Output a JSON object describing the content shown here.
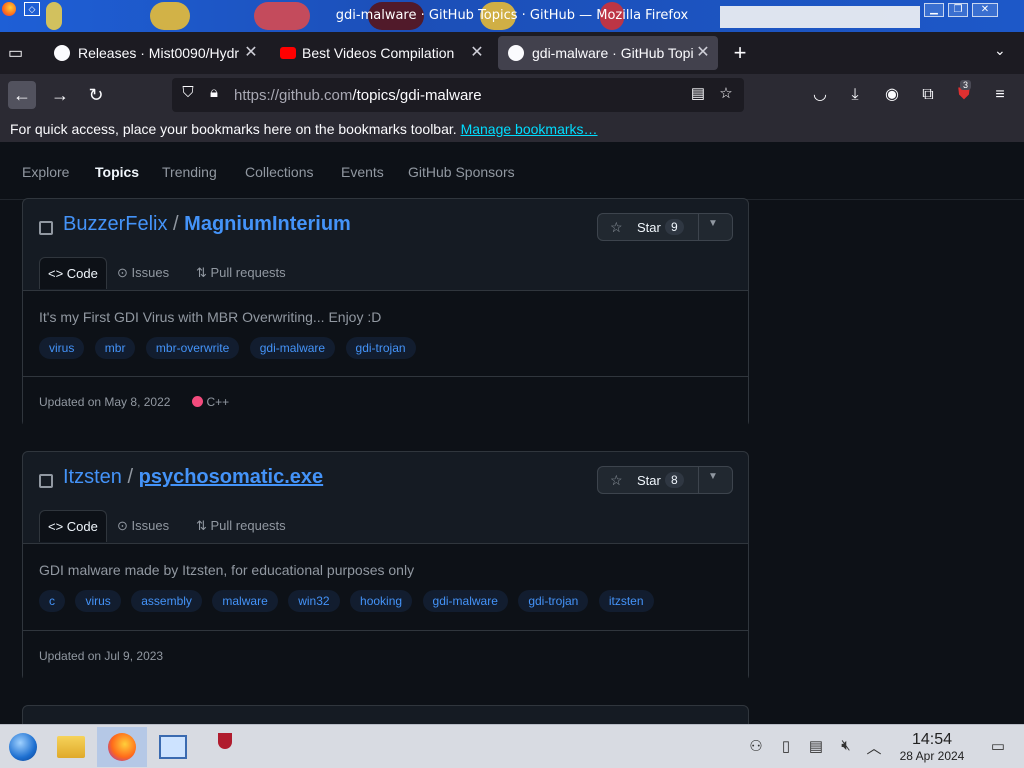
{
  "window": {
    "title": "gdi-malware · GitHub Topics · GitHub — Mozilla Firefox"
  },
  "tabs": [
    {
      "label": "Releases · Mist0090/Hydr",
      "icon": "github-icon",
      "active": false
    },
    {
      "label": "Best Videos Compilation",
      "icon": "youtube-icon",
      "active": false
    },
    {
      "label": "gdi-malware · GitHub Topi",
      "icon": "github-icon",
      "active": true
    }
  ],
  "navbar": {
    "url_host": "https://github.com",
    "url_path": "/topics/gdi-malware",
    "extension_badge": "3"
  },
  "bookmarks": {
    "prompt": "For quick access, place your bookmarks here on the bookmarks toolbar.",
    "link": "Manage bookmarks…"
  },
  "subnav": {
    "items": [
      "Explore",
      "Topics",
      "Trending",
      "Collections",
      "Events",
      "GitHub Sponsors"
    ],
    "active": "Topics"
  },
  "repos": [
    {
      "owner": "BuzzerFelix",
      "name": "MagniumInterium",
      "star_label": "Star",
      "stars": "9",
      "tabs": [
        "Code",
        "Issues",
        "Pull requests"
      ],
      "description": "It's my First GDI Virus with MBR Overwriting... Enjoy :D",
      "topics": [
        "virus",
        "mbr",
        "mbr-overwrite",
        "gdi-malware",
        "gdi-trojan"
      ],
      "updated": "Updated on May 8, 2022",
      "language": "C++",
      "language_color": "#f34b7d"
    },
    {
      "owner": "Itzsten",
      "name": "psychosomatic.exe",
      "star_label": "Star",
      "stars": "8",
      "tabs": [
        "Code",
        "Issues",
        "Pull requests"
      ],
      "description": "GDI malware made by Itzsten, for educational purposes only",
      "topics": [
        "c",
        "virus",
        "assembly",
        "malware",
        "win32",
        "hooking",
        "gdi-malware",
        "gdi-trojan",
        "itzsten"
      ],
      "updated": "Updated on Jul 9, 2023"
    }
  ],
  "taskbar": {
    "apps": [
      "start-orb",
      "file-manager",
      "firefox",
      "remote-desktop",
      "wine"
    ],
    "time": "14:54",
    "date": "28 Apr 2024"
  },
  "colors": {
    "link": "#4493f8",
    "bg": "#0d1117",
    "accent_cyan": "#00ddff"
  }
}
